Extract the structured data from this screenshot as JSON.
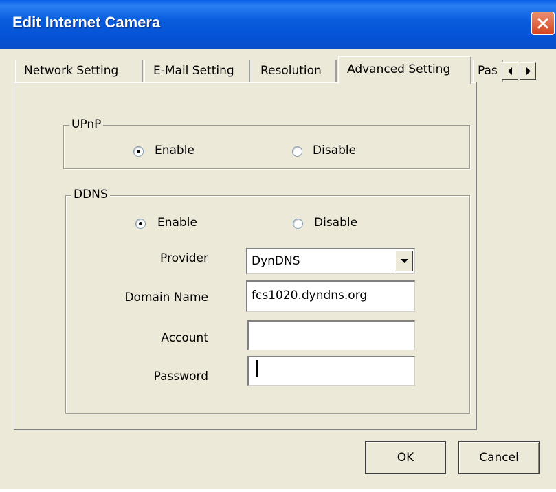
{
  "window": {
    "title": "Edit Internet Camera"
  },
  "tabs": [
    {
      "label": "Network Setting"
    },
    {
      "label": "E-Mail Setting"
    },
    {
      "label": "Resolution"
    },
    {
      "label": "Advanced Setting"
    },
    {
      "label": "Pas"
    }
  ],
  "upnp": {
    "title": "UPnP",
    "enable_label": "Enable",
    "disable_label": "Disable",
    "selected": "Enable"
  },
  "ddns": {
    "title": "DDNS",
    "enable_label": "Enable",
    "disable_label": "Disable",
    "selected": "Enable",
    "provider_label": "Provider",
    "provider_value": "DynDNS",
    "domain_label": "Domain Name",
    "domain_value": "fcs1020.dyndns.org",
    "account_label": "Account",
    "account_value": "",
    "password_label": "Password",
    "password_value": ""
  },
  "buttons": {
    "ok": "OK",
    "cancel": "Cancel"
  },
  "icons": {
    "close": "close-icon",
    "scroll_left": "arrow-left-icon",
    "scroll_right": "arrow-right-icon",
    "dropdown": "chevron-down-icon"
  },
  "colors": {
    "titlebar": "#0a5ddd",
    "dialog": "#ece9d8",
    "close": "#d5431b"
  }
}
